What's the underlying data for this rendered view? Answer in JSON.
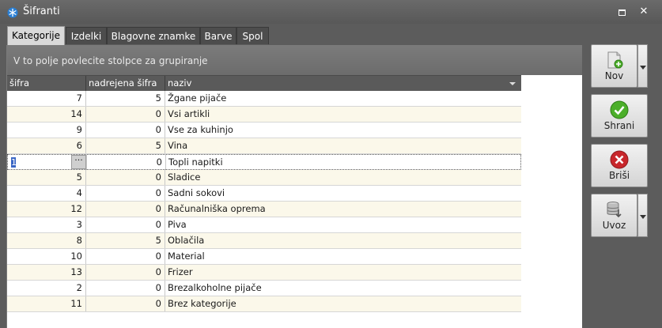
{
  "window": {
    "title": "Šifranti"
  },
  "tabs": [
    {
      "label": "Kategorije",
      "active": true
    },
    {
      "label": "Izdelki"
    },
    {
      "label": "Blagovne znamke"
    },
    {
      "label": "Barve"
    },
    {
      "label": "Spol"
    }
  ],
  "grid": {
    "group_hint": "V to polje povlecite stolpce za grupiranje",
    "columns": [
      "šifra",
      "nadrejena šifra",
      "naziv"
    ],
    "editing_value": "1",
    "rows": [
      {
        "sifra": "7",
        "nadrejena": "5",
        "naziv": "Žgane pijače"
      },
      {
        "sifra": "14",
        "nadrejena": "0",
        "naziv": "Vsi artikli"
      },
      {
        "sifra": "9",
        "nadrejena": "0",
        "naziv": "Vse za kuhinjo"
      },
      {
        "sifra": "6",
        "nadrejena": "5",
        "naziv": "Vina"
      },
      {
        "sifra": "",
        "nadrejena": "0",
        "naziv": "Topli napitki"
      },
      {
        "sifra": "5",
        "nadrejena": "0",
        "naziv": "Sladice"
      },
      {
        "sifra": "4",
        "nadrejena": "0",
        "naziv": "Sadni sokovi"
      },
      {
        "sifra": "12",
        "nadrejena": "0",
        "naziv": "Računalniška oprema"
      },
      {
        "sifra": "3",
        "nadrejena": "0",
        "naziv": "Piva"
      },
      {
        "sifra": "8",
        "nadrejena": "5",
        "naziv": "Oblačila"
      },
      {
        "sifra": "10",
        "nadrejena": "0",
        "naziv": "Material"
      },
      {
        "sifra": "13",
        "nadrejena": "0",
        "naziv": "Frizer"
      },
      {
        "sifra": "2",
        "nadrejena": "0",
        "naziv": "Brezalkoholne pijače"
      },
      {
        "sifra": "11",
        "nadrejena": "0",
        "naziv": "Brez kategorije"
      }
    ]
  },
  "actions": {
    "new_label": "Nov",
    "save_label": "Shrani",
    "delete_label": "Briši",
    "import_label": "Uvoz"
  },
  "colors": {
    "accent_green": "#4caf2a",
    "accent_red": "#c8262b",
    "row_alt": "#fbf8ea"
  }
}
